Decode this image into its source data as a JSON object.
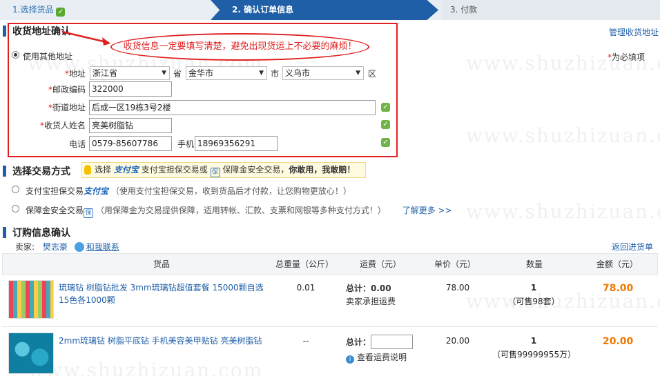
{
  "steps": {
    "step1": "1.选择货品",
    "step2": "2. 确认订单信息",
    "step3": "3. 付款"
  },
  "watermark": "www.shuzhizuan.com",
  "address": {
    "title": "收货地址确认",
    "manage_link": "管理收货地址",
    "notice": "收货信息一定要填写清楚，避免出现货运上不必要的麻烦！",
    "use_other": "使用其他地址",
    "required_hint": "为必填项",
    "labels": {
      "region": "地址",
      "postcode": "邮政编码",
      "street": "街道地址",
      "receiver": "收货人姓名",
      "phone": "电话",
      "mobile": "手机"
    },
    "province": "浙江省",
    "province_suffix": "省",
    "city": "金华市",
    "city_suffix": "市",
    "district": "义乌市",
    "district_suffix": "区",
    "postcode": "322000",
    "street": "后成一区19栋3号2楼",
    "receiver": "亮美树脂钻",
    "phone": "0579-85607786",
    "mobile": "18969356291"
  },
  "payment": {
    "title": "选择交易方式",
    "tip_prefix": "选择",
    "tip_logo": "支付宝",
    "tip_mid": "支付宝担保交易或",
    "tip_mid2": "保障金安全交易，",
    "tip_strong": "你敢用，我敢赔！",
    "options": [
      {
        "label": "支付宝担保交易",
        "logo": "支付宝",
        "desc": "（使用支付宝担保交易，收到货品后才付款，让您购物更放心！）"
      },
      {
        "label": "保障金安全交易",
        "desc": "（用保障金为交易提供保障，适用转帐、汇款、支票和网银等多种支付方式！）",
        "more": "了解更多 >>"
      }
    ]
  },
  "order": {
    "title": "订购信息确认",
    "seller_label": "卖家:",
    "seller_name": "樊志豪",
    "contact": "和我联系",
    "back_link": "返回进货单",
    "columns": [
      "货品",
      "总重量（公斤）",
      "运费（元）",
      "单价（元）",
      "数量",
      "金额（元）"
    ],
    "rows": [
      {
        "name": "琉璃钻 树脂钻批发 3mm琉璃钻超值套餐 15000颗自选15色各1000颗",
        "weight": "0.01",
        "freight_label": "总计：",
        "freight_value": "0.00",
        "freight_note": "卖家承担运费",
        "unit_price": "78.00",
        "qty": "1",
        "qty_note": "（可售98套）",
        "amount": "78.00"
      },
      {
        "name": "2mm琉璃钻 树脂平底钻 手机美容美甲贴钻 亮美树脂钻",
        "weight": "--",
        "freight_label": "总计：",
        "freight_value": "",
        "freight_note": "查看运费说明",
        "unit_price": "20.00",
        "qty": "1",
        "qty_note": "（可售99999955万）",
        "amount": "20.00"
      }
    ]
  },
  "colors": {
    "accent": "#1f5fa8",
    "alert": "#e02020",
    "price": "#f07800"
  }
}
